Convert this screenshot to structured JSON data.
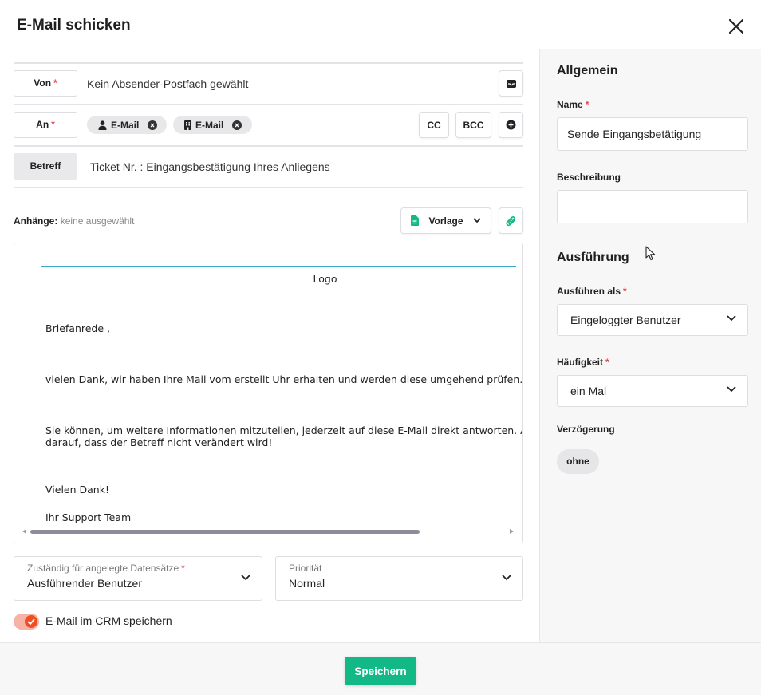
{
  "dialog": {
    "title": "E-Mail schicken"
  },
  "von": {
    "label": "Von",
    "value": "Kein Absender-Postfach gewählt"
  },
  "an": {
    "label": "An",
    "recipients": [
      {
        "icon": "person-icon",
        "label": "E-Mail"
      },
      {
        "icon": "building-icon",
        "label": "E-Mail"
      }
    ],
    "cc_label": "CC",
    "bcc_label": "BCC"
  },
  "betreff": {
    "label": "Betreff",
    "value": "Ticket Nr. : Eingangsbestätigung Ihres Anliegens"
  },
  "attachments": {
    "label": "Anhänge:",
    "value": "keine ausgewählt",
    "template_label": "Vorlage"
  },
  "editor": {
    "logo": "Logo",
    "lines": [
      "Briefanrede ,",
      "vielen Dank, wir haben Ihre Mail vom erstellt Uhr erhalten und werden diese umgehend prüfen.",
      "Sie können, um weitere Informationen mitzuteilen, jederzeit auf diese E-Mail direkt antworten. Ac",
      "darauf, dass der Betreff nicht verändert wird!",
      "Vielen Dank!",
      "Ihr Support Team"
    ]
  },
  "zustaendig": {
    "label": "Zuständig für angelegte Datensätze",
    "value": "Ausführender Benutzer"
  },
  "prioritaet": {
    "label": "Priorität",
    "value": "Normal"
  },
  "crm_toggle": {
    "label": "E-Mail im CRM speichern",
    "checked": true
  },
  "footer": {
    "save_label": "Speichern"
  },
  "right_panel": {
    "allgemein_title": "Allgemein",
    "name_label": "Name",
    "name_value": "Sende Eingangsbetätigung",
    "beschreibung_label": "Beschreibung",
    "beschreibung_value": "",
    "ausfuehrung_title": "Ausführung",
    "ausfuehren_als_label": "Ausführen als",
    "ausfuehren_als_value": "Eingeloggter Benutzer",
    "haeufigkeit_label": "Häufigkeit",
    "haeufigkeit_value": "ein Mal",
    "verzoegerung_label": "Verzögerung",
    "verzoegerung_value": "ohne"
  },
  "colors": {
    "primary": "#12b886",
    "required": "#e5484d",
    "toggle": "#f04e23",
    "accent_line": "#3aa9c5"
  }
}
